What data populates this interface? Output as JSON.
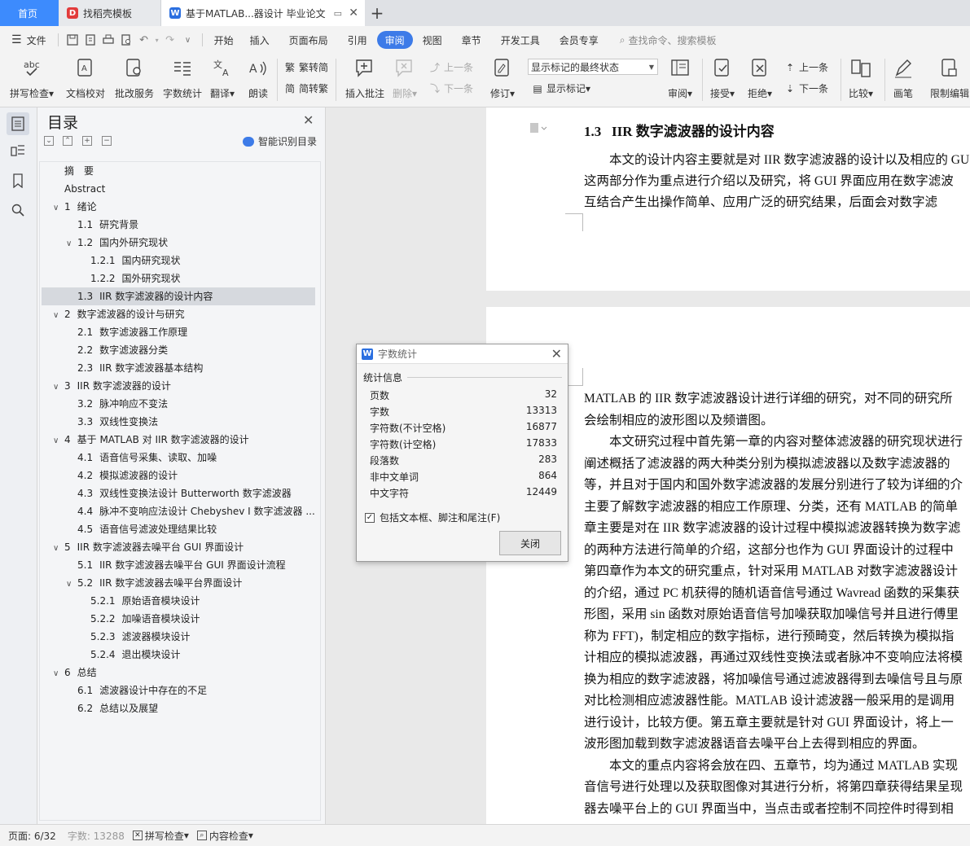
{
  "tabs": {
    "home": "首页",
    "template": "找稻壳模板",
    "doc": "基于MATLAB...器设计 毕业论文"
  },
  "menu": {
    "file": "文件",
    "items": [
      "开始",
      "插入",
      "页面布局",
      "引用",
      "审阅",
      "视图",
      "章节",
      "开发工具",
      "会员专享"
    ],
    "search": "查找命令、搜索模板"
  },
  "ribbon": {
    "spellcheck": "拼写检查",
    "doc_proof": "文档校对",
    "batch_service": "批改服务",
    "word_count": "字数统计",
    "translate": "翻译",
    "read_aloud": "朗读",
    "to_traditional": "繁转简",
    "to_simplified": "简转繁",
    "insert_comment": "插入批注",
    "delete": "删除",
    "prev_comment": "上一条",
    "next_comment": "下一条",
    "revise": "修订",
    "markup_state": "显示标记的最终状态",
    "show_markup": "显示标记",
    "review": "审阅",
    "accept": "接受",
    "reject": "拒绝",
    "prev_change": "上一条",
    "next_change": "下一条",
    "compare": "比较",
    "pen": "画笔",
    "restrict": "限制编辑"
  },
  "toc": {
    "title": "目录",
    "smart": "智能识别目录",
    "items": [
      {
        "chev": "",
        "num": "",
        "text": "摘　要",
        "indent": 0
      },
      {
        "chev": "",
        "num": "",
        "text": "Abstract",
        "indent": 0
      },
      {
        "chev": "∨",
        "num": "1",
        "text": "绪论",
        "indent": 0
      },
      {
        "chev": "",
        "num": "1.1",
        "text": "研究背景",
        "indent": 1
      },
      {
        "chev": "∨",
        "num": "1.2",
        "text": "国内外研究现状",
        "indent": 1
      },
      {
        "chev": "",
        "num": "1.2.1",
        "text": "国内研究现状",
        "indent": 2
      },
      {
        "chev": "",
        "num": "1.2.2",
        "text": "国外研究现状",
        "indent": 2
      },
      {
        "chev": "",
        "num": "1.3",
        "text": "IIR 数字滤波器的设计内容",
        "indent": 1
      },
      {
        "chev": "∨",
        "num": "2",
        "text": "数字滤波器的设计与研究",
        "indent": 0
      },
      {
        "chev": "",
        "num": "2.1",
        "text": "数字滤波器工作原理",
        "indent": 1
      },
      {
        "chev": "",
        "num": "2.2",
        "text": "数字滤波器分类",
        "indent": 1
      },
      {
        "chev": "",
        "num": "2.3",
        "text": "IIR 数字滤波器基本结构",
        "indent": 1
      },
      {
        "chev": "∨",
        "num": "3",
        "text": "IIR 数字滤波器的设计",
        "indent": 0
      },
      {
        "chev": "",
        "num": "3.2",
        "text": "脉冲响应不变法",
        "indent": 1
      },
      {
        "chev": "",
        "num": "3.3",
        "text": "双线性变换法",
        "indent": 1
      },
      {
        "chev": "∨",
        "num": "4",
        "text": "基于 MATLAB 对 IIR 数字滤波器的设计",
        "indent": 0
      },
      {
        "chev": "",
        "num": "4.1",
        "text": "语音信号采集、读取、加噪",
        "indent": 1
      },
      {
        "chev": "",
        "num": "4.2",
        "text": "模拟滤波器的设计",
        "indent": 1
      },
      {
        "chev": "",
        "num": "4.3",
        "text": "双线性变换法设计 Butterworth 数字滤波器",
        "indent": 1
      },
      {
        "chev": "",
        "num": "4.4",
        "text": "脉冲不变响应法设计 Chebyshev I 数字滤波器 ...",
        "indent": 1
      },
      {
        "chev": "",
        "num": "4.5",
        "text": "语音信号滤波处理结果比较",
        "indent": 1
      },
      {
        "chev": "∨",
        "num": "5",
        "text": "IIR 数字滤波器去噪平台 GUI 界面设计",
        "indent": 0
      },
      {
        "chev": "",
        "num": "5.1",
        "text": "IIR 数字滤波器去噪平台 GUI 界面设计流程",
        "indent": 1
      },
      {
        "chev": "∨",
        "num": "5.2",
        "text": "IIR 数字滤波器去噪平台界面设计",
        "indent": 1
      },
      {
        "chev": "",
        "num": "5.2.1",
        "text": "原始语音模块设计",
        "indent": 2
      },
      {
        "chev": "",
        "num": "5.2.2",
        "text": "加噪语音模块设计",
        "indent": 2
      },
      {
        "chev": "",
        "num": "5.2.3",
        "text": "滤波器模块设计",
        "indent": 2
      },
      {
        "chev": "",
        "num": "5.2.4",
        "text": "退出模块设计",
        "indent": 2
      },
      {
        "chev": "∨",
        "num": "6",
        "text": "总结",
        "indent": 0
      },
      {
        "chev": "",
        "num": "6.1",
        "text": "滤波器设计中存在的不足",
        "indent": 1
      },
      {
        "chev": "",
        "num": "6.2",
        "text": "总结以及展望",
        "indent": 1
      }
    ]
  },
  "doc": {
    "heading_num": "1.3",
    "heading": "IIR 数字滤波器的设计内容",
    "page1_lines": [
      "　　本文的设计内容主要就是对 IIR 数字滤波器的设计以及相应的 GU",
      "这两部分作为重点进行介绍以及研究，将 GUI 界面应用在数字滤波",
      "互结合产生出操作简单、应用广泛的研究结果，后面会对数字滤"
    ],
    "page2_lines": [
      "MATLAB 的 IIR 数字滤波器设计进行详细的研究，对不同的研究所",
      "会绘制相应的波形图以及频谱图。",
      "　　本文研究过程中首先第一章的内容对整体滤波器的研究现状进行",
      "阐述概括了滤波器的两大种类分别为模拟滤波器以及数字滤波器的",
      "等，并且对于国内和国外数字滤波器的发展分别进行了较为详细的介",
      "主要了解数字滤波器的相应工作原理、分类，还有 MATLAB 的简单",
      "章主要是对在 IIR 数字滤波器的设计过程中模拟滤波器转换为数字滤",
      "的两种方法进行简单的介绍，这部分也作为 GUI 界面设计的过程中",
      "第四章作为本文的研究重点，针对采用 MATLAB 对数字滤波器设计",
      "的介绍，通过 PC 机获得的随机语音信号通过 Wavread 函数的采集获",
      "形图，采用 sin 函数对原始语音信号加噪获取加噪信号并且进行傅里",
      "称为 FFT)，制定相应的数字指标，进行预畸变，然后转换为模拟指",
      "计相应的模拟滤波器，再通过双线性变换法或者脉冲不变响应法将模",
      "换为相应的数字滤波器，将加噪信号通过滤波器得到去噪信号且与原",
      "对比检测相应滤波器性能。MATLAB 设计滤波器一般采用的是调用",
      "进行设计，比较方便。第五章主要就是针对 GUI 界面设计，将上一",
      "波形图加载到数字滤波器语音去噪平台上去得到相应的界面。",
      "　　本文的重点内容将会放在四、五章节，均为通过 MATLAB 实现",
      "音信号进行处理以及获取图像对其进行分析，将第四章获得结果呈现",
      "器去噪平台上的 GUI 界面当中，当点击或者控制不同控件时得到相"
    ]
  },
  "dialog": {
    "title": "字数统计",
    "section": "统计信息",
    "stats": [
      {
        "label": "页数",
        "value": "32"
      },
      {
        "label": "字数",
        "value": "13313"
      },
      {
        "label": "字符数(不计空格)",
        "value": "16877"
      },
      {
        "label": "字符数(计空格)",
        "value": "17833"
      },
      {
        "label": "段落数",
        "value": "283"
      },
      {
        "label": "非中文单词",
        "value": "864"
      },
      {
        "label": "中文字符",
        "value": "12449"
      }
    ],
    "include_label": "包括文本框、脚注和尾注(F)",
    "close_label": "关闭"
  },
  "status": {
    "page": "页面: 6/32",
    "words": "字数: 13288",
    "spell": "拼写检查",
    "content": "内容检查"
  }
}
